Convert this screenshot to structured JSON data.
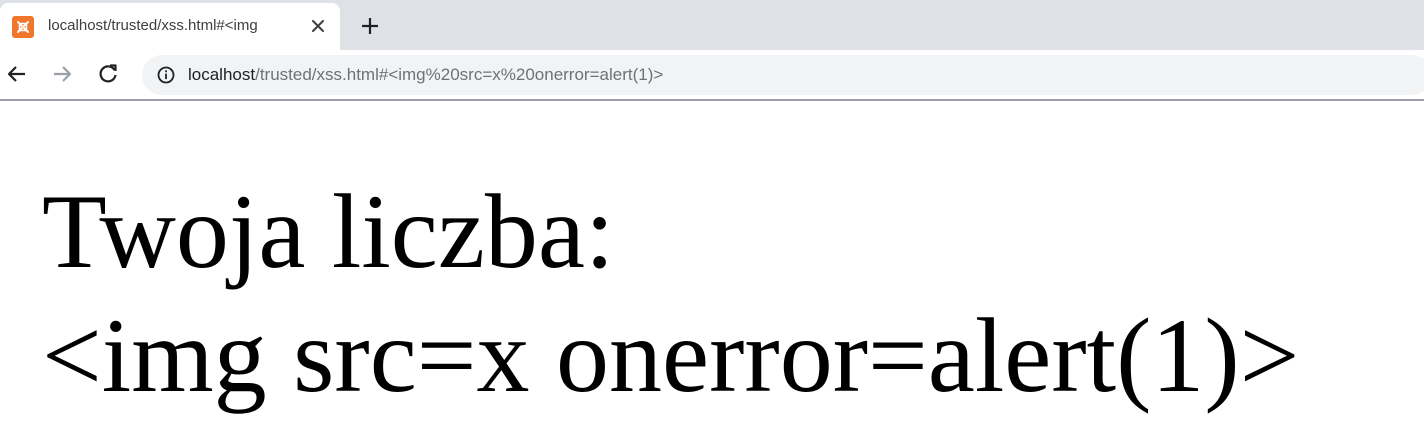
{
  "browser": {
    "tab": {
      "title": "localhost/trusted/xss.html#<img",
      "favicon": "xampp-icon",
      "favicon_color": "#f0762c"
    },
    "new_tab_icon": "plus-icon",
    "nav": {
      "back_icon": "arrow-left-icon",
      "forward_icon": "arrow-right-icon",
      "reload_icon": "reload-icon"
    },
    "address_bar": {
      "host": "localhost",
      "path": "/trusted/xss.html#<img%20src=x%20onerror=alert(1)>",
      "info_icon": "info-icon"
    }
  },
  "page": {
    "line1": "Twoja liczba:",
    "line2": "<img src=x onerror=alert(1)>"
  }
}
